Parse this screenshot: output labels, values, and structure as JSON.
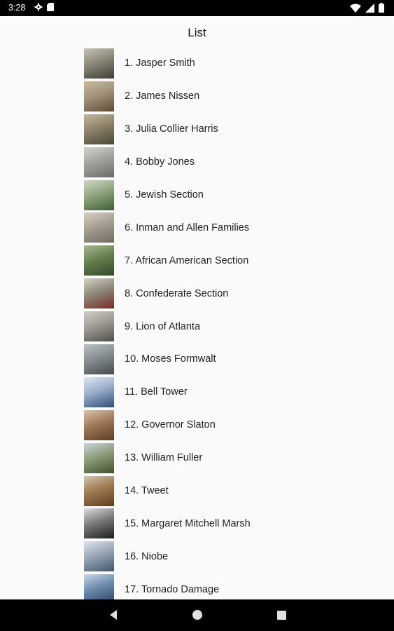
{
  "status_bar": {
    "time": "3:28",
    "icons": [
      "gear-icon",
      "sd-card-icon",
      "wifi-icon",
      "signal-icon",
      "battery-icon"
    ]
  },
  "page": {
    "title": "List"
  },
  "list": {
    "items": [
      {
        "label": "1. Jasper Smith",
        "thumb_colors": [
          "#3d3d36",
          "#8a8778",
          "#c6c3b6"
        ]
      },
      {
        "label": "2. James Nissen",
        "thumb_colors": [
          "#5d4a33",
          "#a1937c",
          "#c9b9a0"
        ]
      },
      {
        "label": "3. Julia Collier Harris",
        "thumb_colors": [
          "#4a4637",
          "#8e826a",
          "#c4b99f"
        ]
      },
      {
        "label": "4. Bobby Jones",
        "thumb_colors": [
          "#6a6a66",
          "#a3a29d",
          "#d4d3ce"
        ]
      },
      {
        "label": "5. Jewish Section",
        "thumb_colors": [
          "#3f5d34",
          "#8fa57f",
          "#d2d6c8"
        ]
      },
      {
        "label": "6. Inman and Allen Families",
        "thumb_colors": [
          "#6f6a61",
          "#a69e91",
          "#d8d2c6"
        ]
      },
      {
        "label": "7. African American Section",
        "thumb_colors": [
          "#34472a",
          "#66804f",
          "#a9b693"
        ]
      },
      {
        "label": "8. Confederate Section",
        "thumb_colors": [
          "#7a2b24",
          "#8d8a7c",
          "#d5d2c7"
        ]
      },
      {
        "label": "9. Lion of Atlanta",
        "thumb_colors": [
          "#4f4e49",
          "#9d9b93",
          "#d0cdc4"
        ]
      },
      {
        "label": "10. Moses Formwalt",
        "thumb_colors": [
          "#444a4e",
          "#868d90",
          "#b9c1c4"
        ]
      },
      {
        "label": "11. Bell Tower",
        "thumb_colors": [
          "#2e4b78",
          "#9cafcc",
          "#dde4ef"
        ]
      },
      {
        "label": "12. Governor Slaton",
        "thumb_colors": [
          "#5b3e22",
          "#a0785a",
          "#d8c7ad"
        ]
      },
      {
        "label": "13. William Fuller",
        "thumb_colors": [
          "#41512f",
          "#8c9c77",
          "#c9d4e0"
        ]
      },
      {
        "label": "14. Tweet",
        "thumb_colors": [
          "#5d3c1b",
          "#9f7a52",
          "#d3c5b0"
        ]
      },
      {
        "label": "15. Margaret Mitchell Marsh",
        "thumb_colors": [
          "#1e1e1e",
          "#7a7a7a",
          "#dedede"
        ]
      },
      {
        "label": "16. Niobe",
        "thumb_colors": [
          "#43556f",
          "#98a6b6",
          "#dfe4ea"
        ]
      },
      {
        "label": "17. Tornado Damage",
        "thumb_colors": [
          "#2a3e5c",
          "#6b89ad",
          "#c9d6e6"
        ]
      }
    ]
  },
  "nav_bar": {
    "buttons": [
      "back-icon",
      "home-icon",
      "recents-icon"
    ]
  }
}
